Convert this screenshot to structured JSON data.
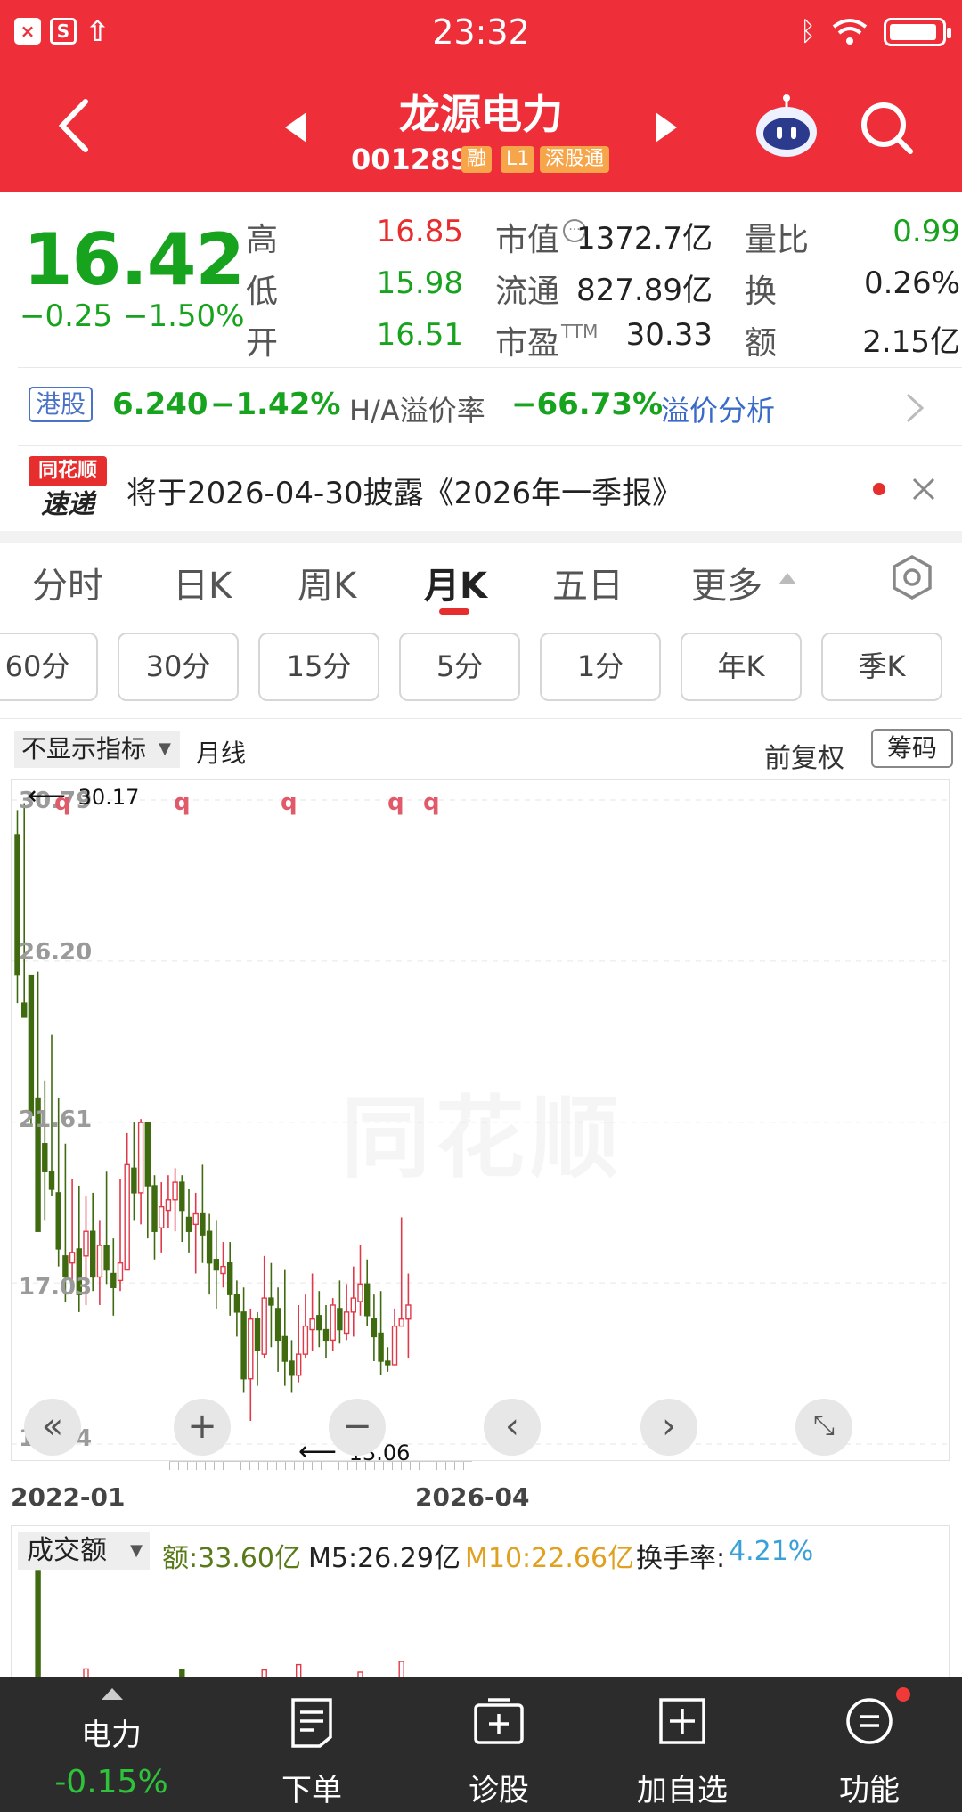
{
  "status_bar": {
    "time": "23:32"
  },
  "header": {
    "stock_name": "龙源电力",
    "stock_code": "001289",
    "tags": [
      "融",
      "L1",
      "深股通"
    ]
  },
  "quote": {
    "price": "16.42",
    "change": "−0.25",
    "change_pct": "−1.50%",
    "high_label": "高",
    "high": "16.85",
    "low_label": "低",
    "low": "15.98",
    "open_label": "开",
    "open": "16.51",
    "mktcap_label": "市值",
    "mktcap": "1372.7亿",
    "float_label": "流通",
    "float": "827.89亿",
    "pe_label": "市盈",
    "pe_suffix": "TTM",
    "pe": "30.33",
    "vol_ratio_label": "量比",
    "vol_ratio": "0.99",
    "turnover_label": "换",
    "turnover": "0.26%",
    "amount_label": "额",
    "amount": "2.15亿"
  },
  "hk": {
    "tag": "港股",
    "price": "6.240",
    "change_pct": "−1.42%",
    "premium_label": "H/A溢价率",
    "premium": "−66.73%",
    "link": "溢价分析"
  },
  "news": {
    "brand_top": "同花顺",
    "brand_bottom": "速递",
    "text": "将于2026-04-30披露《2026年一季报》"
  },
  "tabs": [
    "分时",
    "日K",
    "周K",
    "月K",
    "五日",
    "更多"
  ],
  "active_tab": "月K",
  "periods": [
    "60分",
    "30分",
    "15分",
    "5分",
    "1分",
    "年K",
    "季K"
  ],
  "chart_toolbar": {
    "indicator": "不显示指标",
    "line_type": "月线",
    "adjust": "前复权",
    "chips": "筹码"
  },
  "chart_data": {
    "type": "candlestick",
    "y_ticks": [
      "30.79",
      "26.20",
      "21.61",
      "17.03",
      "12.44"
    ],
    "x_labels": [
      "2022-01",
      "2026-04"
    ],
    "max_marker": "30.17",
    "min_marker": "13.06",
    "watermark": "同花顺",
    "event_marker": "q",
    "ylim": [
      12.44,
      30.79
    ],
    "candles": [
      [
        29.8,
        30.5,
        25.8,
        25.0
      ],
      [
        25.0,
        30.7,
        24.6,
        24.6
      ],
      [
        25.8,
        25.0,
        21.8,
        21.5
      ],
      [
        22.3,
        25.9,
        18.5,
        19.8
      ],
      [
        21.0,
        22.8,
        20.2,
        18.8
      ],
      [
        20.2,
        24.1,
        19.7,
        19.5
      ],
      [
        19.6,
        22.3,
        18.0,
        17.5
      ],
      [
        17.8,
        21.0,
        17.2,
        16.5
      ],
      [
        17.6,
        20.0,
        17.9,
        16.8
      ],
      [
        18.0,
        19.8,
        16.7,
        16.2
      ],
      [
        17.8,
        19.5,
        18.5,
        16.4
      ],
      [
        18.5,
        19.6,
        17.2,
        16.8
      ],
      [
        17.2,
        18.8,
        18.1,
        16.4
      ],
      [
        18.1,
        20.2,
        17.4,
        17.0
      ],
      [
        17.3,
        18.3,
        16.9,
        16.1
      ],
      [
        17.1,
        20.0,
        17.6,
        16.8
      ],
      [
        17.4,
        21.3,
        20.4,
        17.4
      ],
      [
        20.3,
        21.6,
        19.6,
        18.8
      ],
      [
        19.6,
        21.7,
        21.6,
        18.7
      ],
      [
        21.6,
        21.6,
        19.8,
        18.3
      ],
      [
        19.8,
        20.1,
        18.5,
        17.7
      ],
      [
        18.6,
        19.9,
        19.2,
        17.9
      ],
      [
        19.1,
        20.1,
        19.4,
        18.6
      ],
      [
        19.4,
        20.3,
        19.9,
        18.5
      ],
      [
        19.9,
        20.1,
        19.1,
        18.2
      ],
      [
        18.9,
        19.7,
        18.5,
        17.9
      ],
      [
        18.7,
        19.6,
        19.0,
        17.3
      ],
      [
        19.0,
        20.4,
        18.4,
        17.6
      ],
      [
        18.5,
        19.0,
        17.6,
        16.7
      ],
      [
        17.7,
        18.8,
        17.4,
        16.3
      ],
      [
        17.3,
        18.2,
        17.5,
        16.9
      ],
      [
        17.6,
        18.2,
        16.7,
        16.1
      ],
      [
        16.7,
        17.1,
        16.2,
        15.5
      ],
      [
        16.2,
        16.9,
        14.3,
        13.9
      ],
      [
        14.3,
        16.3,
        16.0,
        13.1
      ],
      [
        16.0,
        16.2,
        15.1,
        14.1
      ],
      [
        15.0,
        17.8,
        16.6,
        14.9
      ],
      [
        16.6,
        17.6,
        16.4,
        15.2
      ],
      [
        16.3,
        16.9,
        15.4,
        14.5
      ],
      [
        15.5,
        17.4,
        14.8,
        14.1
      ],
      [
        14.8,
        15.4,
        14.4,
        13.9
      ],
      [
        14.4,
        16.4,
        15.0,
        14.2
      ],
      [
        15.0,
        16.7,
        15.8,
        14.9
      ],
      [
        15.7,
        17.3,
        16.0,
        15.1
      ],
      [
        16.1,
        16.8,
        15.7,
        15.2
      ],
      [
        15.7,
        16.4,
        15.4,
        14.9
      ],
      [
        15.4,
        16.6,
        16.4,
        15.1
      ],
      [
        16.3,
        17.1,
        15.7,
        15.3
      ],
      [
        15.6,
        17.0,
        16.2,
        15.4
      ],
      [
        16.2,
        17.5,
        16.6,
        15.5
      ],
      [
        16.5,
        18.1,
        17.0,
        16.1
      ],
      [
        17.0,
        17.7,
        16.1,
        15.8
      ],
      [
        16.0,
        16.7,
        15.5,
        14.8
      ],
      [
        15.6,
        16.8,
        14.8,
        14.4
      ],
      [
        14.8,
        15.2,
        14.7,
        14.5
      ],
      [
        14.7,
        16.3,
        15.8,
        14.7
      ],
      [
        15.8,
        18.9,
        16.0,
        15.9
      ],
      [
        16.0,
        17.3,
        16.4,
        14.9
      ]
    ],
    "volume_label": "成交额",
    "volume_amount": "额:33.60亿",
    "m5": "M5:26.29亿",
    "m10": "M10:22.66亿",
    "turnover_rate_label": "换手率:",
    "turnover_rate": "4.21%",
    "volume_bars": [
      {
        "idx": 3,
        "value": 1.0
      },
      {
        "idx": 10,
        "value": 0.03
      },
      {
        "idx": 24,
        "value": 0.02
      },
      {
        "idx": 36,
        "value": 0.02
      },
      {
        "idx": 41,
        "value": 0.12
      },
      {
        "idx": 50,
        "value": 0.05
      },
      {
        "idx": 56,
        "value": 0.15
      }
    ]
  },
  "bottom_nav": {
    "sector_name": "电力",
    "sector_change": "-0.15%",
    "items": [
      "下单",
      "诊股",
      "加自选",
      "功能"
    ]
  },
  "colors": {
    "brand_red": "#ee2f3a",
    "up": "#e62e2e",
    "down": "#18a31f",
    "nav_bg": "#2c2c2c"
  }
}
